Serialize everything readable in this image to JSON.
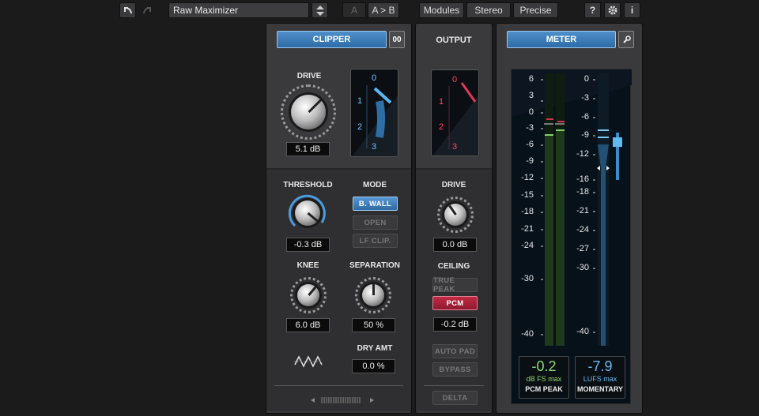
{
  "toolbar": {
    "preset_name": "Raw Maximizer",
    "ab_a": "A",
    "ab_copy": "A > B",
    "view_tabs": [
      "Modules",
      "Stereo",
      "Precise"
    ],
    "help_label": "?",
    "info_label": "i"
  },
  "clipper": {
    "title": "CLIPPER",
    "link_label": "00",
    "drive_label": "DRIVE",
    "drive_value": "5.1 dB",
    "threshold_label": "THRESHOLD",
    "threshold_value": "-0.3 dB",
    "mode_label": "MODE",
    "mode_options": [
      "B. WALL",
      "OPEN",
      "LF CLIP."
    ],
    "mode_selected": "B. WALL",
    "knee_label": "KNEE",
    "knee_value": "6.0 dB",
    "separation_label": "SEPARATION",
    "separation_value": "50 %",
    "dry_amt_label": "DRY AMT",
    "dry_amt_value": "0.0 %",
    "mini_meter_ticks": [
      "0",
      "1",
      "2",
      "3"
    ]
  },
  "output": {
    "title": "OUTPUT",
    "drive_label": "DRIVE",
    "drive_value": "0.0 dB",
    "ceiling_label": "CEILING",
    "true_peak_label": "TRUE PEAK",
    "pcm_label": "PCM",
    "ceiling_value": "-0.2 dB",
    "auto_pad_label": "AUTO PAD",
    "bypass_label": "BYPASS",
    "delta_label": "DELTA",
    "mini_meter_ticks": [
      "0",
      "1",
      "2",
      "3"
    ]
  },
  "meter": {
    "title": "METER",
    "peak_scale": [
      "6",
      "3",
      "0",
      "-3",
      "-6",
      "-9",
      "-12",
      "-15",
      "-18",
      "-21",
      "-24",
      "-30",
      "-40"
    ],
    "loudness_scale": [
      "0",
      "-3",
      "-6",
      "-9",
      "-12",
      "-16",
      "-18",
      "-21",
      "-24",
      "-27",
      "-30",
      "-40"
    ],
    "pcm_peak_value": "-0.2",
    "pcm_peak_unit": "dB FS max",
    "pcm_peak_label": "PCM PEAK",
    "lufs_value": "-7.9",
    "lufs_unit": "LUFS max",
    "lufs_label": "MOMENTARY"
  },
  "colors": {
    "accent_blue": "#3b7fc0",
    "pcm_red": "#b0223a",
    "peak_green": "#7fd06a",
    "lufs_blue": "#58b6f0"
  },
  "icons": [
    "undo-icon",
    "redo-icon",
    "settings-gear-icon",
    "wrench-icon",
    "waveform-icon"
  ]
}
